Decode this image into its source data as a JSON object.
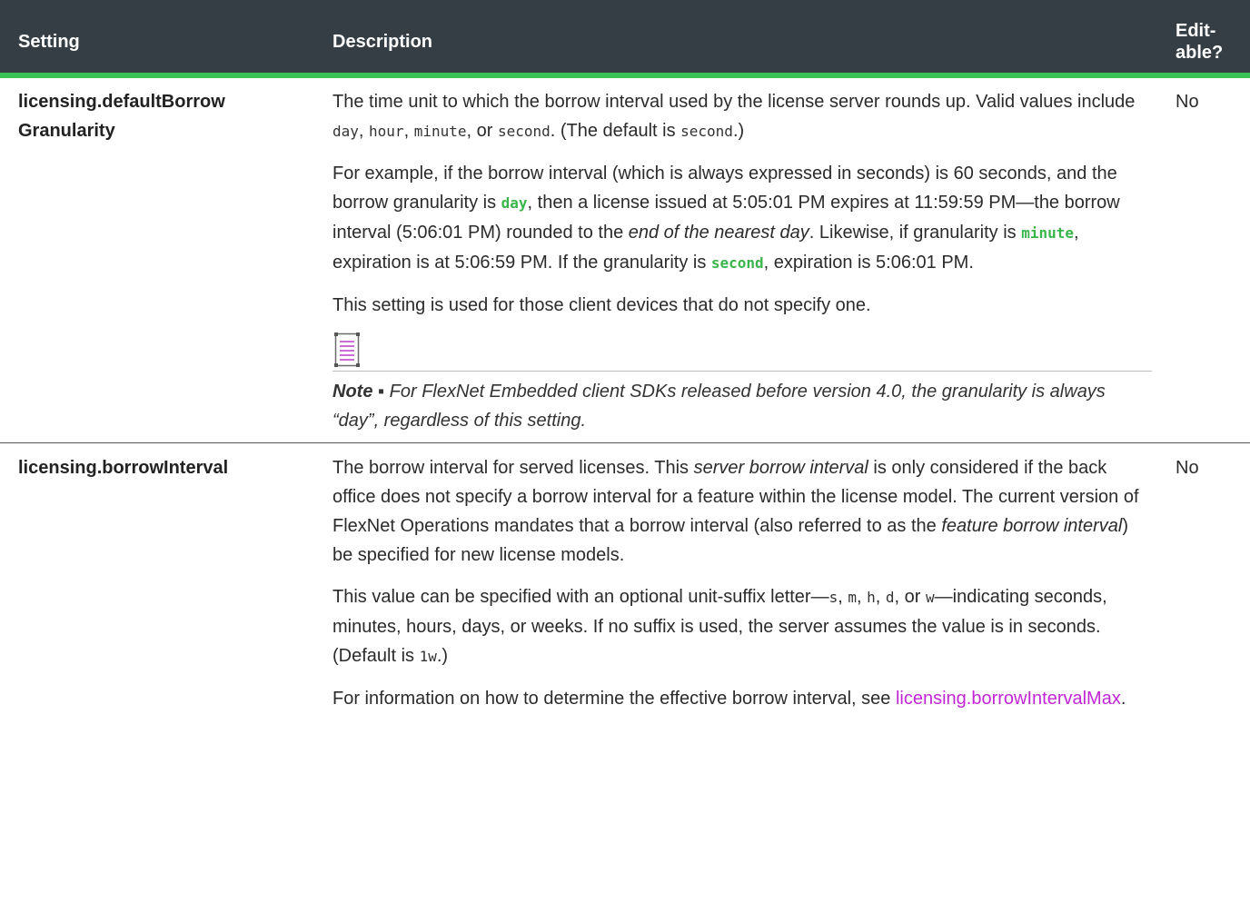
{
  "header": {
    "setting": "Setting",
    "description": "Description",
    "editable_line1": "Edit-",
    "editable_line2": "able?"
  },
  "rows": [
    {
      "name_line1": "licensing.defaultBorrow",
      "name_line2": "Granularity",
      "editable": "No",
      "p1": {
        "t1": "The time unit to which the borrow interval used by the license server rounds up. Valid values include ",
        "c1": "day",
        "t2": ", ",
        "c2": "hour",
        "t3": ", ",
        "c3": "minute",
        "t4": ", or ",
        "c4": "second",
        "t5": ". (The default is ",
        "c5": "second",
        "t6": ".)"
      },
      "p2": {
        "t1": "For example, if the borrow interval (which is always expressed in seconds) is 60 seconds, and the borrow granularity is ",
        "c1": "day",
        "t2": ", then a license issued at 5:05:01 PM expires at 11:59:59 PM—the borrow interval (5:06:01 PM) rounded to the ",
        "i1": "end of the nearest day",
        "t3": ". Likewise, if granularity is ",
        "c2": "minute",
        "t4": ", expiration is at 5:06:59 PM. If the granularity is ",
        "c3": "second",
        "t5": ", expiration is 5:06:01 PM."
      },
      "p3": "This setting is used for those client devices that do not specify one.",
      "note": {
        "icon": "note-icon",
        "label": "Note ▪ ",
        "text": "For FlexNet Embedded client SDKs released before version 4.0, the granularity is always “day”, regardless of this setting."
      }
    },
    {
      "name": "licensing.borrowInterval",
      "editable": "No",
      "p1": {
        "t1": "The borrow interval for served licenses. This ",
        "i1": "server borrow interval",
        "t2": " is only considered if the back office does not specify a borrow interval for a feature within the license model. The current version of FlexNet Operations mandates that a borrow interval (also referred to as the ",
        "i2": "feature borrow interval",
        "t3": ") be specified for new license models."
      },
      "p2": {
        "t1": "This value can be specified with an optional unit-suffix letter—",
        "c1": "s",
        "t2": ", ",
        "c2": "m",
        "t3": ", ",
        "c3": "h",
        "t4": ", ",
        "c4": "d",
        "t5": ", or ",
        "c5": "w",
        "t6": "—indicating seconds, minutes, hours, days, or weeks. If no suffix is used, the server assumes the value is in seconds. (Default is ",
        "c6": "1w",
        "t7": ".)"
      },
      "p3": {
        "t1": "For information on how to determine the effective borrow interval, see ",
        "link": "licensing.borrowIntervalMax",
        "t2": "."
      }
    }
  ],
  "colors": {
    "header_bg": "#353e45",
    "header_rule": "#3ac254",
    "code_highlight": "#3ab54a",
    "link": "#c026d3"
  }
}
